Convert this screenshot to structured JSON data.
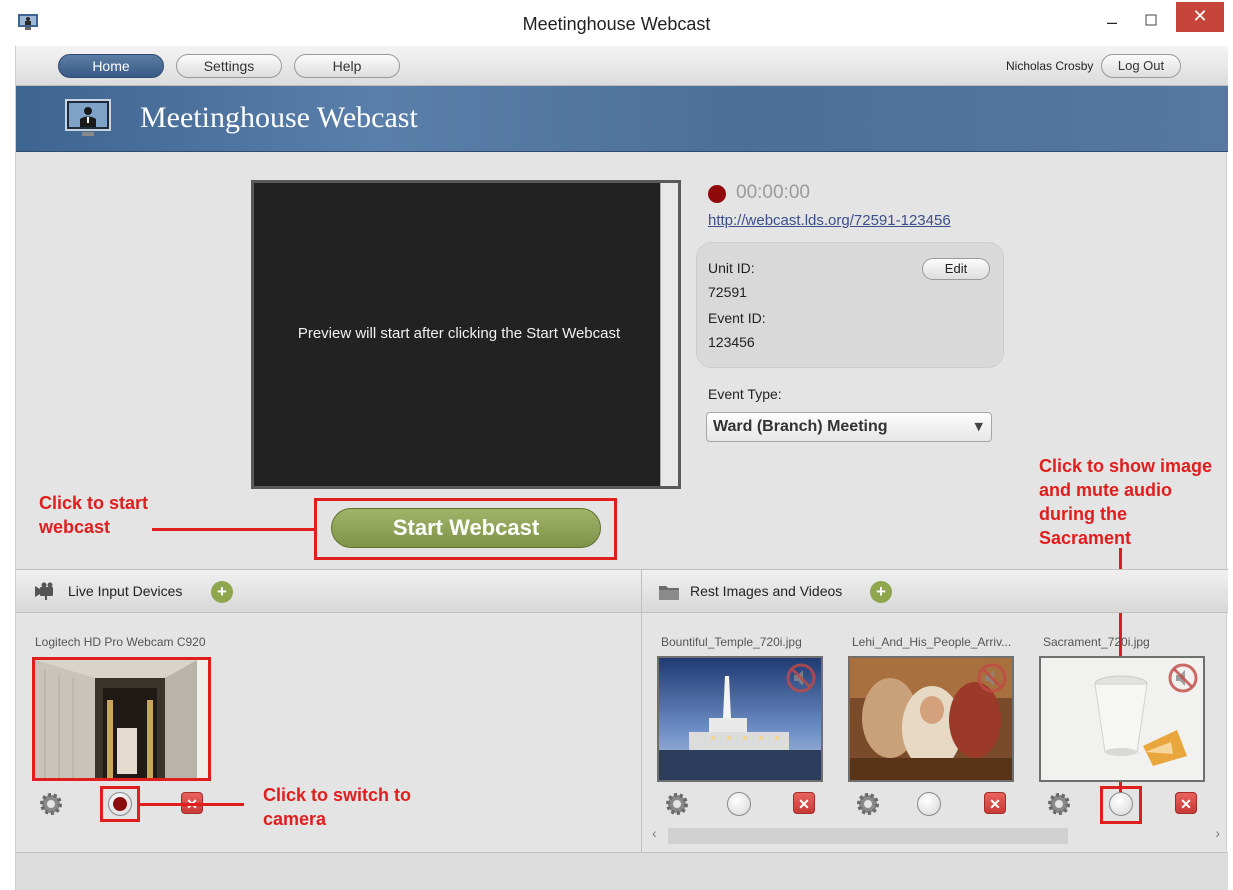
{
  "window": {
    "title": "Meetinghouse Webcast",
    "minimize": "–",
    "close": "✕"
  },
  "nav": {
    "tabs": [
      {
        "label": "Home",
        "active": true
      },
      {
        "label": "Settings",
        "active": false
      },
      {
        "label": "Help",
        "active": false
      }
    ],
    "user_name": "Nicholas Crosby",
    "logout_label": "Log Out"
  },
  "banner": {
    "title": "Meetinghouse Webcast"
  },
  "preview": {
    "message": "Preview will start after clicking the Start Webcast",
    "start_button": "Start Webcast"
  },
  "info": {
    "timer": "00:00:00",
    "url": "http://webcast.lds.org/72591-123456",
    "unit_id_label": "Unit ID:",
    "unit_id": "72591",
    "event_id_label": "Event ID:",
    "event_id": "123456",
    "edit_label": "Edit",
    "event_type_label": "Event Type:",
    "event_type": "Ward (Branch) Meeting"
  },
  "annotations": {
    "start": "Click to start webcast",
    "camera": "Click to switch to camera",
    "sacrament": "Click to show image and mute audio during the Sacrament"
  },
  "live_devices": {
    "title": "Live Input Devices",
    "items": [
      {
        "name": "Logitech HD Pro Webcam C920",
        "live": true
      }
    ]
  },
  "rest_images": {
    "title": "Rest Images and Videos",
    "items": [
      {
        "name": "Bountiful_Temple_720i.jpg"
      },
      {
        "name": "Lehi_And_His_People_Arriv..."
      },
      {
        "name": "Sacrament_720i.jpg"
      }
    ]
  },
  "colors": {
    "accent_blue": "#385a85",
    "start_green": "#8fa64d",
    "annotation_red": "#e01e1e",
    "record_red": "#8f0a0a"
  },
  "icons": {
    "app": "webcast-presenter-icon",
    "settings": "gear-icon",
    "delete": "close-icon",
    "mute": "mute-icon",
    "camera": "camera-icon",
    "folder": "folder-icon",
    "add": "plus-icon"
  }
}
